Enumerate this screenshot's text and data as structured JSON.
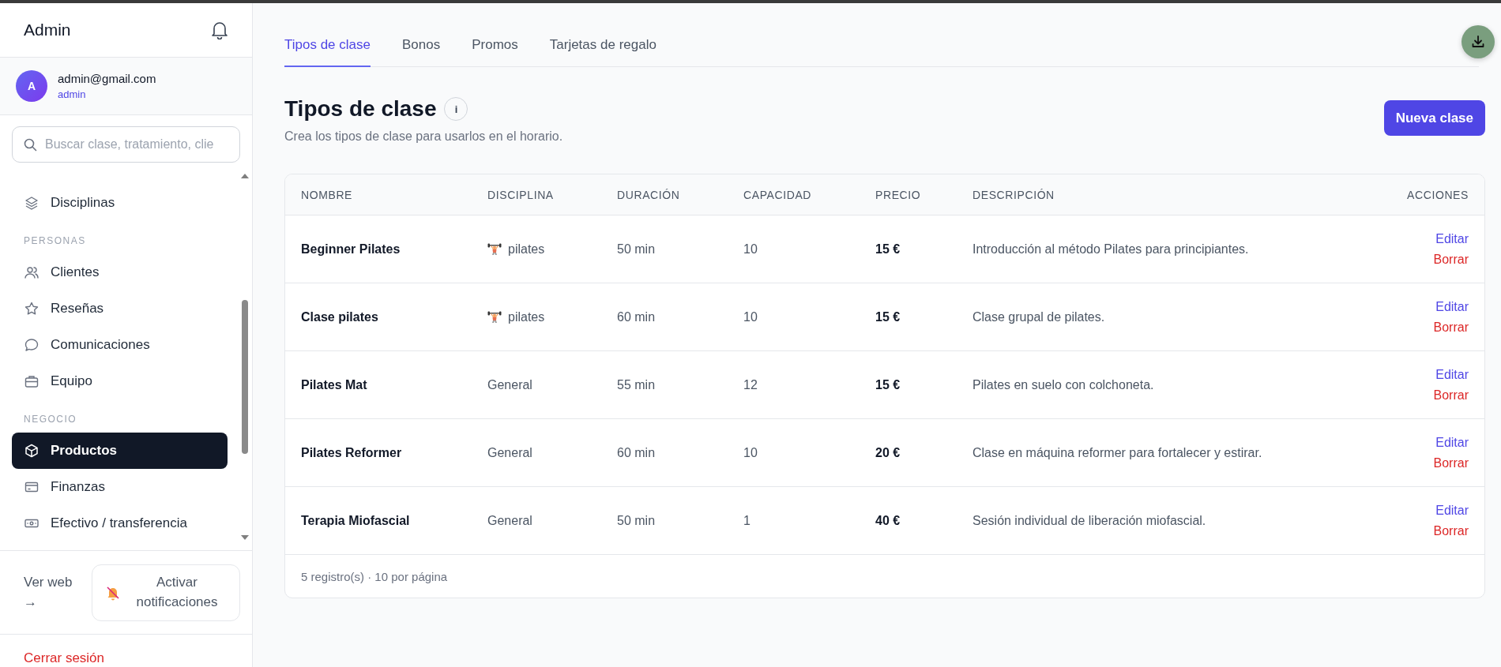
{
  "sidebar": {
    "title": "Admin",
    "user": {
      "avatar": "A",
      "email": "admin@gmail.com",
      "role": "admin"
    },
    "search": {
      "placeholder": "Buscar clase, tratamiento, clie"
    },
    "nav": [
      {
        "kind": "item",
        "label": "Disciplinas",
        "selected": false
      },
      {
        "kind": "section",
        "label": "PERSONAS"
      },
      {
        "kind": "item",
        "label": "Clientes",
        "selected": false
      },
      {
        "kind": "item",
        "label": "Reseñas",
        "selected": false
      },
      {
        "kind": "item",
        "label": "Comunicaciones",
        "selected": false
      },
      {
        "kind": "item",
        "label": "Equipo",
        "selected": false
      },
      {
        "kind": "section",
        "label": "NEGOCIO"
      },
      {
        "kind": "item",
        "label": "Productos",
        "selected": true
      },
      {
        "kind": "item",
        "label": "Finanzas",
        "selected": false
      },
      {
        "kind": "item",
        "label": "Efectivo / transferencia",
        "selected": false
      }
    ],
    "web_link": "Ver web →",
    "notifications_button": "Activar notificaciones",
    "logout": "Cerrar sesión"
  },
  "tabs": [
    {
      "label": "Tipos de clase",
      "selected": true
    },
    {
      "label": "Bonos",
      "selected": false
    },
    {
      "label": "Promos",
      "selected": false
    },
    {
      "label": "Tarjetas de regalo",
      "selected": false
    }
  ],
  "page": {
    "title": "Tipos de clase",
    "info": "i",
    "subtitle": "Crea los tipos de clase para usarlos en el horario.",
    "new_button": "Nueva clase"
  },
  "table": {
    "columns": [
      "NOMBRE",
      "DISCIPLINA",
      "DURACIÓN",
      "CAPACIDAD",
      "PRECIO",
      "DESCRIPCIÓN",
      "ACCIONES"
    ],
    "rows": [
      {
        "name": "Beginner Pilates",
        "discipline": {
          "kind": "sport",
          "label": "pilates"
        },
        "duration": "50 min",
        "capacity": "10",
        "price": "15 €",
        "description": "Introducción al método Pilates para principiantes.",
        "actions": [
          "Editar",
          "Borrar"
        ]
      },
      {
        "name": "Clase pilates",
        "discipline": {
          "kind": "sport",
          "label": "pilates"
        },
        "duration": "60 min",
        "capacity": "10",
        "price": "15 €",
        "description": "Clase grupal de pilates.",
        "actions": [
          "Editar",
          "Borrar"
        ]
      },
      {
        "name": "Pilates Mat",
        "discipline": {
          "kind": "plain",
          "label": "General"
        },
        "duration": "55 min",
        "capacity": "12",
        "price": "15 €",
        "description": "Pilates en suelo con colchoneta.",
        "actions": [
          "Editar",
          "Borrar"
        ]
      },
      {
        "name": "Pilates Reformer",
        "discipline": {
          "kind": "plain",
          "label": "General"
        },
        "duration": "60 min",
        "capacity": "10",
        "price": "20 €",
        "description": "Clase en máquina reformer para fortalecer y estirar.",
        "actions": [
          "Editar",
          "Borrar"
        ]
      },
      {
        "name": "Terapia Miofascial",
        "discipline": {
          "kind": "plain",
          "label": "General"
        },
        "duration": "50 min",
        "capacity": "1",
        "price": "40 €",
        "description": "Sesión individual de liberación miofascial.",
        "actions": [
          "Editar",
          "Borrar"
        ]
      }
    ],
    "footer": "5 registro(s) · 10 por página"
  }
}
